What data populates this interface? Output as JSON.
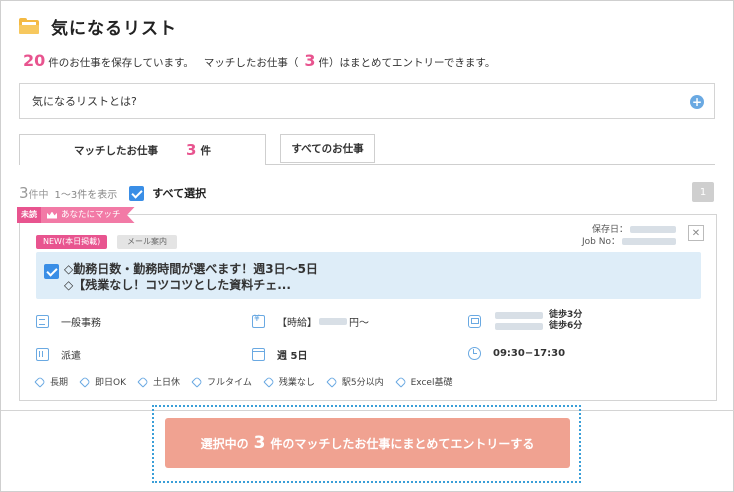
{
  "header": {
    "title": "気になるリスト",
    "icon": "folder-icon"
  },
  "summary": {
    "saved_count": "20",
    "saved_text": "件のお仕事を保存しています。",
    "match_text_pre": "マッチしたお仕事（",
    "match_count": "3",
    "match_text_post": "件）はまとめてエントリーできます。"
  },
  "faq": {
    "label": "気になるリストとは?",
    "icon": "plus-icon"
  },
  "tabs": [
    {
      "label": "マッチしたお仕事",
      "count": "3",
      "unit": "件",
      "active": true
    },
    {
      "label": "すべてのお仕事",
      "active": false
    }
  ],
  "list_bar": {
    "total": "3",
    "total_unit": "件中",
    "range": "1〜3件を表示",
    "select_all": "すべて選択",
    "page": "1"
  },
  "job": {
    "unread": "未読",
    "match_badge": "あなたにマッチ",
    "new_badge": "NEW(本日掲載)",
    "mail_badge": "メール案内",
    "saved_label": "保存日：",
    "jobno_label": "Job No：",
    "title_line1": "◇勤務日数・勤務時間が選べます！週3日〜5日",
    "title_line2": "◇【残業なし！コツコツとした資料チェ...",
    "category": "一般事務",
    "wage_label": "【時給】",
    "wage_suffix": "円〜",
    "walk1": "徒歩3分",
    "walk2": "徒歩6分",
    "employment": "派遣",
    "days": "週 5日",
    "hours": "09:30−17:30",
    "tags": [
      "長期",
      "即日OK",
      "土日休",
      "フルタイム",
      "残業なし",
      "駅5分以内",
      "Excel基礎"
    ]
  },
  "entry": {
    "pre": "選択中の",
    "count": "3",
    "post": "件のマッチしたお仕事にまとめてエントリーする"
  },
  "colors": {
    "accent_pink": "#e8548f",
    "accent_blue": "#3a8ee6",
    "button": "#f0a291"
  }
}
